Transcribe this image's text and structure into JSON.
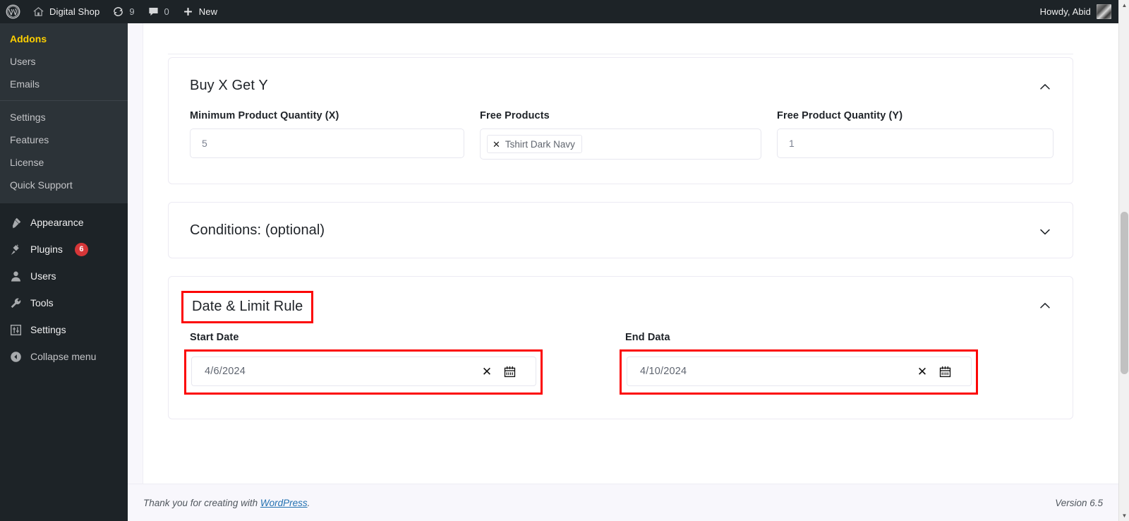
{
  "adminbar": {
    "logo_icon": "wordpress-logo-icon",
    "site": {
      "icon": "home-icon",
      "label": "Digital Shop"
    },
    "updates": {
      "icon": "updates-icon",
      "count": "9"
    },
    "comments": {
      "icon": "comment-icon",
      "count": "0"
    },
    "new": {
      "icon": "plus-icon",
      "label": "New"
    },
    "account": {
      "label": "Howdy, Abid",
      "avatar": "user-avatar"
    }
  },
  "sidebar": {
    "submenu": [
      {
        "label": "Addons",
        "current": true
      },
      {
        "label": "Users",
        "current": false
      },
      {
        "label": "Emails",
        "current": false
      }
    ],
    "submenu_group2": [
      {
        "label": "Settings"
      },
      {
        "label": "Features"
      },
      {
        "label": "License"
      },
      {
        "label": "Quick Support"
      }
    ],
    "menu": [
      {
        "label": "Appearance",
        "icon": "appearance-brush-icon",
        "badge": null
      },
      {
        "label": "Plugins",
        "icon": "plugins-plug-icon",
        "badge": "6"
      },
      {
        "label": "Users",
        "icon": "users-person-icon",
        "badge": null
      },
      {
        "label": "Tools",
        "icon": "tools-wrench-icon",
        "badge": null
      },
      {
        "label": "Settings",
        "icon": "settings-sliders-icon",
        "badge": null
      }
    ],
    "collapse": {
      "label": "Collapse menu",
      "icon": "collapse-arrow-left-icon"
    }
  },
  "main": {
    "buy_x_get_y": {
      "title": "Buy X Get Y",
      "toggle_icon": "chevron-up-icon",
      "fields": {
        "min_qty": {
          "label": "Minimum Product Quantity (X)",
          "value": "5"
        },
        "free_products": {
          "label": "Free Products",
          "tags": [
            {
              "label": "Tshirt Dark Navy",
              "remove_icon": "close-x-icon"
            }
          ]
        },
        "free_qty": {
          "label": "Free Product Quantity (Y)",
          "value": "1"
        }
      }
    },
    "conditions": {
      "title": "Conditions: (optional)",
      "toggle_icon": "chevron-down-icon"
    },
    "date_limit": {
      "title": "Date & Limit Rule",
      "toggle_icon": "chevron-up-icon",
      "start": {
        "label": "Start Date",
        "value": "4/6/2024",
        "clear_icon": "close-x-icon",
        "calendar_icon": "calendar-icon"
      },
      "end": {
        "label": "End Data",
        "value": "4/10/2024",
        "clear_icon": "close-x-icon",
        "calendar_icon": "calendar-icon"
      }
    }
  },
  "footer": {
    "thanks_prefix": "Thank you for creating with ",
    "wordpress_link": "WordPress",
    "thanks_suffix": ".",
    "version": "Version 6.5"
  },
  "highlight_color": "#fc0606"
}
